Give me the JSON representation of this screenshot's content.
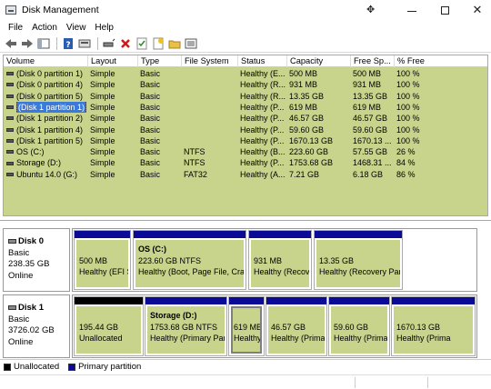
{
  "window": {
    "title": "Disk Management",
    "icons": [
      "disk-management-app-icon",
      "move-icon",
      "minimize-icon",
      "maximize-icon",
      "close-icon"
    ]
  },
  "menu": [
    "File",
    "Action",
    "View",
    "Help"
  ],
  "toolbar": {
    "icons": [
      "back-arrow-icon",
      "forward-arrow-icon",
      "properties-panel-icon",
      "help-icon",
      "console-tree-icon",
      "connect-disk-icon",
      "delete-icon",
      "check-icon",
      "new-volume-icon",
      "open-folder-icon",
      "list-view-icon"
    ]
  },
  "volume_table": {
    "columns": [
      "Volume",
      "Layout",
      "Type",
      "File System",
      "Status",
      "Capacity",
      "Free Sp...",
      "% Free"
    ],
    "rows": [
      {
        "volume": "(Disk 0 partition 1)",
        "layout": "Simple",
        "type": "Basic",
        "fs": "",
        "status": "Healthy (E...",
        "capacity": "500 MB",
        "free": "500 MB",
        "pct": "100 %"
      },
      {
        "volume": "(Disk 0 partition 4)",
        "layout": "Simple",
        "type": "Basic",
        "fs": "",
        "status": "Healthy (R...",
        "capacity": "931 MB",
        "free": "931 MB",
        "pct": "100 %"
      },
      {
        "volume": "(Disk 0 partition 5)",
        "layout": "Simple",
        "type": "Basic",
        "fs": "",
        "status": "Healthy (R...",
        "capacity": "13.35 GB",
        "free": "13.35 GB",
        "pct": "100 %"
      },
      {
        "volume": "(Disk 1 partition 1)",
        "layout": "Simple",
        "type": "Basic",
        "fs": "",
        "status": "Healthy (P...",
        "capacity": "619 MB",
        "free": "619 MB",
        "pct": "100 %",
        "selected": true
      },
      {
        "volume": "(Disk 1 partition 2)",
        "layout": "Simple",
        "type": "Basic",
        "fs": "",
        "status": "Healthy (P...",
        "capacity": "46.57 GB",
        "free": "46.57 GB",
        "pct": "100 %"
      },
      {
        "volume": "(Disk 1 partition 4)",
        "layout": "Simple",
        "type": "Basic",
        "fs": "",
        "status": "Healthy (P...",
        "capacity": "59.60 GB",
        "free": "59.60 GB",
        "pct": "100 %"
      },
      {
        "volume": "(Disk 1 partition 5)",
        "layout": "Simple",
        "type": "Basic",
        "fs": "",
        "status": "Healthy (P...",
        "capacity": "1670.13 GB",
        "free": "1670.13 ...",
        "pct": "100 %"
      },
      {
        "volume": "OS (C:)",
        "layout": "Simple",
        "type": "Basic",
        "fs": "NTFS",
        "status": "Healthy (B...",
        "capacity": "223.60 GB",
        "free": "57.55 GB",
        "pct": "26 %"
      },
      {
        "volume": "Storage (D:)",
        "layout": "Simple",
        "type": "Basic",
        "fs": "NTFS",
        "status": "Healthy (P...",
        "capacity": "1753.68 GB",
        "free": "1468.31 ...",
        "pct": "84 %"
      },
      {
        "volume": "Ubuntu 14.0 (G:)",
        "layout": "Simple",
        "type": "Basic",
        "fs": "FAT32",
        "status": "Healthy (A...",
        "capacity": "7.21 GB",
        "free": "6.18 GB",
        "pct": "86 %"
      }
    ]
  },
  "disks": [
    {
      "name": "Disk 0",
      "type": "Basic",
      "size": "238.35 GB",
      "state": "Online",
      "partitions": [
        {
          "title": "",
          "line1": "500 MB",
          "line2": "Healthy (EFI S",
          "kind": "primary"
        },
        {
          "title": "OS  (C:)",
          "line1": "223.60 GB NTFS",
          "line2": "Healthy (Boot, Page File, Crash",
          "kind": "primary"
        },
        {
          "title": "",
          "line1": "931 MB",
          "line2": "Healthy (Recove",
          "kind": "primary"
        },
        {
          "title": "",
          "line1": "13.35 GB",
          "line2": "Healthy (Recovery Parti",
          "kind": "primary"
        }
      ]
    },
    {
      "name": "Disk 1",
      "type": "Basic",
      "size": "3726.02 GB",
      "state": "Online",
      "partitions": [
        {
          "title": "",
          "line1": "195.44 GB",
          "line2": "Unallocated",
          "kind": "unallocated"
        },
        {
          "title": "Storage  (D:)",
          "line1": "1753.68 GB NTFS",
          "line2": "Healthy (Primary Part",
          "kind": "primary"
        },
        {
          "title": "",
          "line1": "619 MB",
          "line2": "Healthy",
          "kind": "primary",
          "selected": true
        },
        {
          "title": "",
          "line1": "46.57 GB",
          "line2": "Healthy (Primai",
          "kind": "primary"
        },
        {
          "title": "",
          "line1": "59.60 GB",
          "line2": "Healthy (Prima",
          "kind": "primary"
        },
        {
          "title": "",
          "line1": "1670.13 GB",
          "line2": "Healthy (Prima",
          "kind": "primary"
        }
      ]
    }
  ],
  "legend": [
    {
      "label": "Unallocated",
      "color": "#000000"
    },
    {
      "label": "Primary partition",
      "color": "#0a0a96"
    }
  ],
  "colors": {
    "partition_fill": "#c8d38c",
    "primary_bar": "#0a0a96",
    "unallocated_bar": "#000000",
    "selection": "#3b7ad8"
  }
}
